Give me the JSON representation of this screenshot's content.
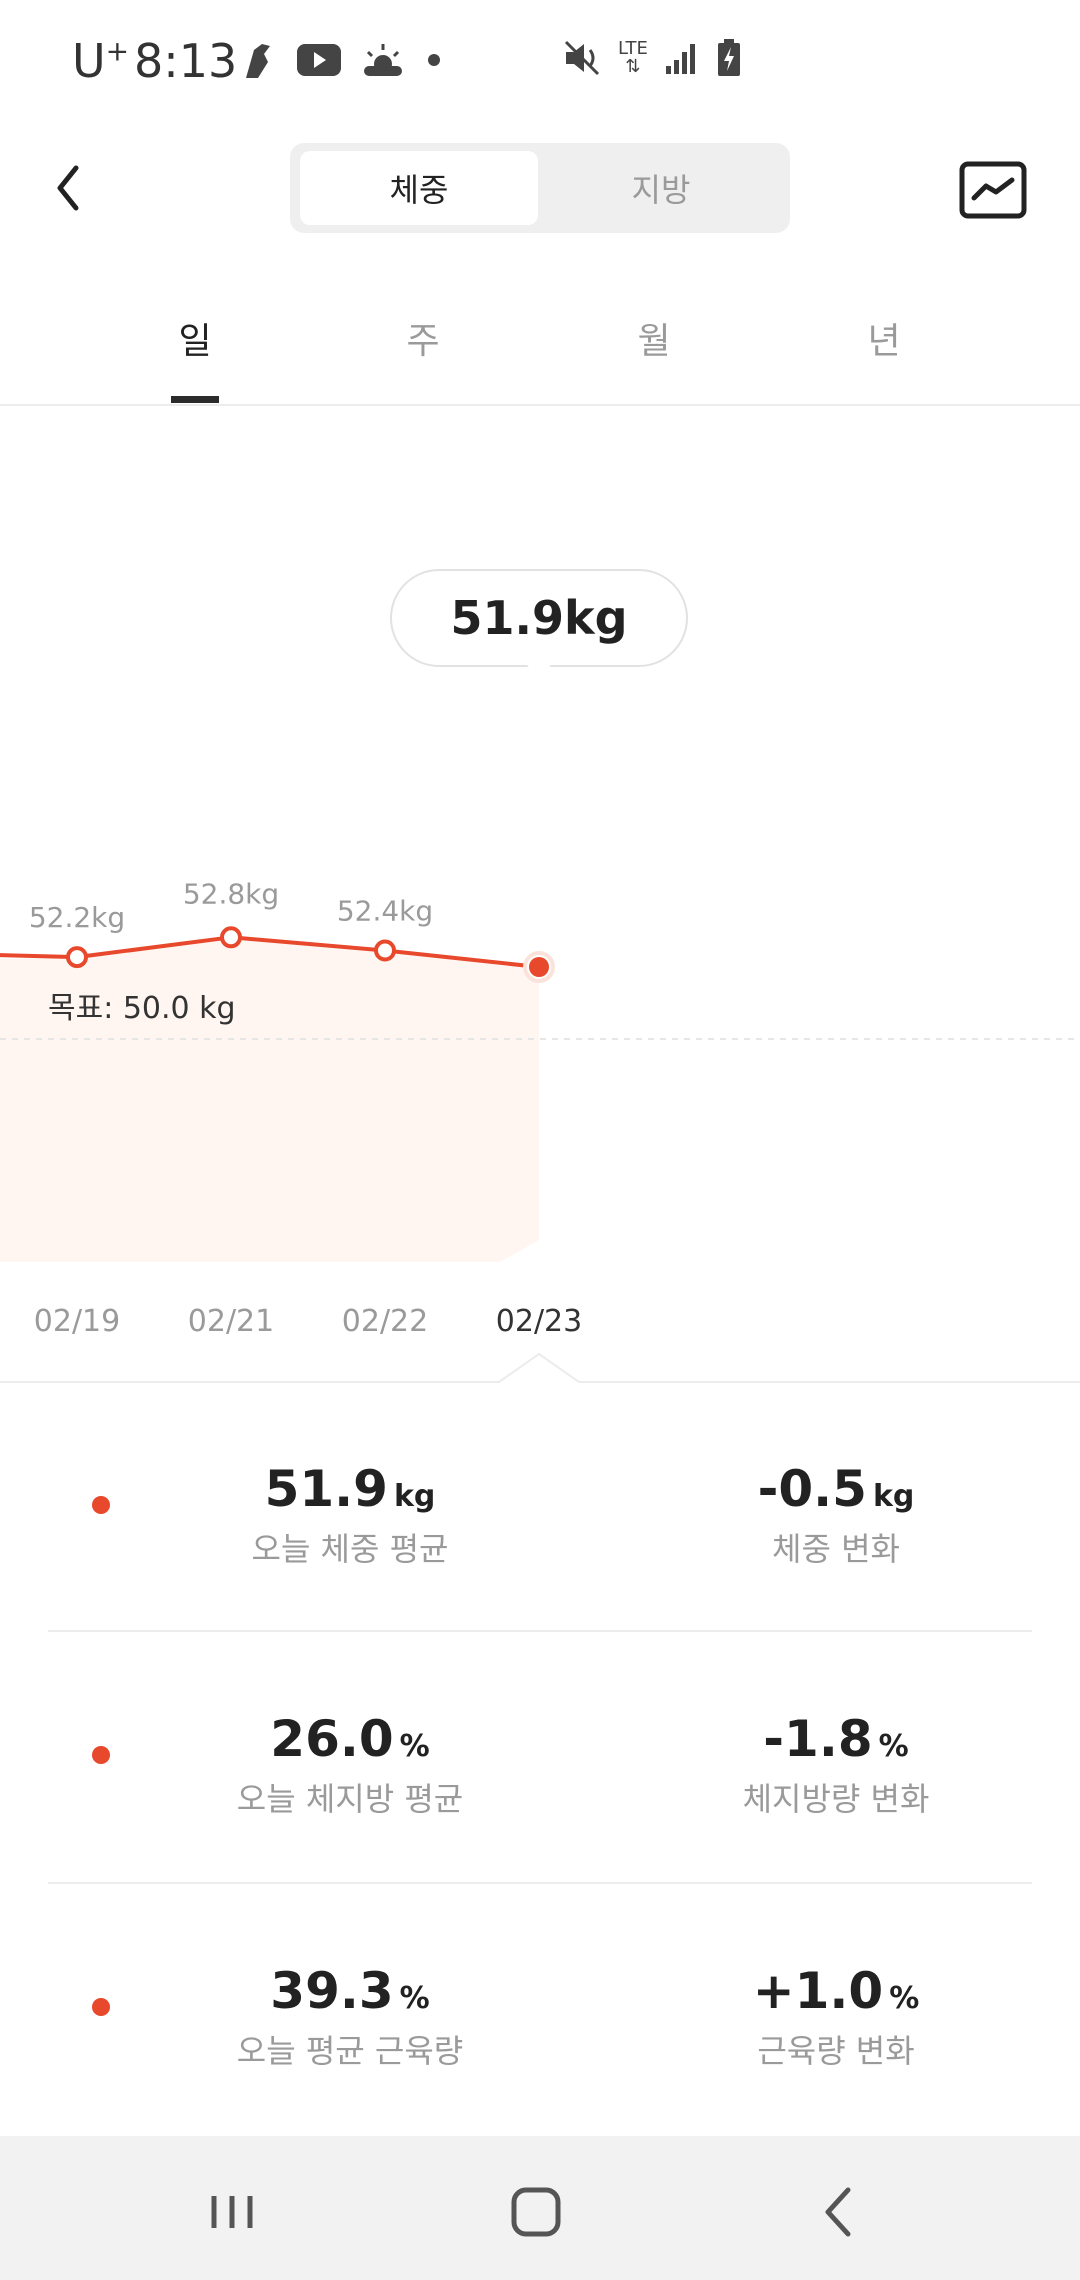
{
  "status_bar": {
    "carrier": "U",
    "carrier_sup": "+",
    "time": "8:13",
    "icons": [
      "sports-icon",
      "youtube-icon",
      "weather-icon",
      "dot-icon"
    ],
    "right_icons": [
      "mute-icon",
      "lte-icon",
      "signal-icon",
      "battery-icon"
    ],
    "lte_text": "LTE"
  },
  "header": {
    "segment": {
      "weight_label": "체중",
      "fat_label": "지방",
      "selected": "체중"
    },
    "back_icon": "chevron-left-icon",
    "trend_icon": "trend-chart-icon"
  },
  "period_tabs": {
    "items": [
      {
        "label": "일"
      },
      {
        "label": "주"
      },
      {
        "label": "월"
      },
      {
        "label": "년"
      }
    ],
    "selected": "일"
  },
  "chart_data": {
    "type": "line",
    "x": [
      "02/19",
      "02/21",
      "02/22",
      "02/23"
    ],
    "series": [
      {
        "values": [
          52.2,
          52.8,
          52.4,
          51.9
        ]
      }
    ],
    "data_labels": [
      "52.2kg",
      "52.8kg",
      "52.4kg",
      "51.9kg"
    ],
    "selected_label": "51.9kg",
    "goal_label": "목표: 50.0 kg",
    "goal_value": 50.0,
    "accent": "#e8482c"
  },
  "summary": {
    "rows": [
      {
        "left": {
          "value": "51.9",
          "unit": "kg",
          "label": "오늘 체중 평균"
        },
        "right": {
          "value": "-0.5",
          "unit": "kg",
          "label": "체중 변화"
        }
      },
      {
        "left": {
          "value": "26.0",
          "unit": "%",
          "label": "오늘 체지방 평균"
        },
        "right": {
          "value": "-1.8",
          "unit": "%",
          "label": "체지방량 변화"
        }
      },
      {
        "left": {
          "value": "39.3",
          "unit": "%",
          "label": "오늘 평균 근육량"
        },
        "right": {
          "value": "+1.0",
          "unit": "%",
          "label": "근육량 변화"
        }
      }
    ]
  },
  "nav_bar": {
    "icons": [
      "recent-apps-icon",
      "home-icon",
      "back-icon"
    ]
  }
}
